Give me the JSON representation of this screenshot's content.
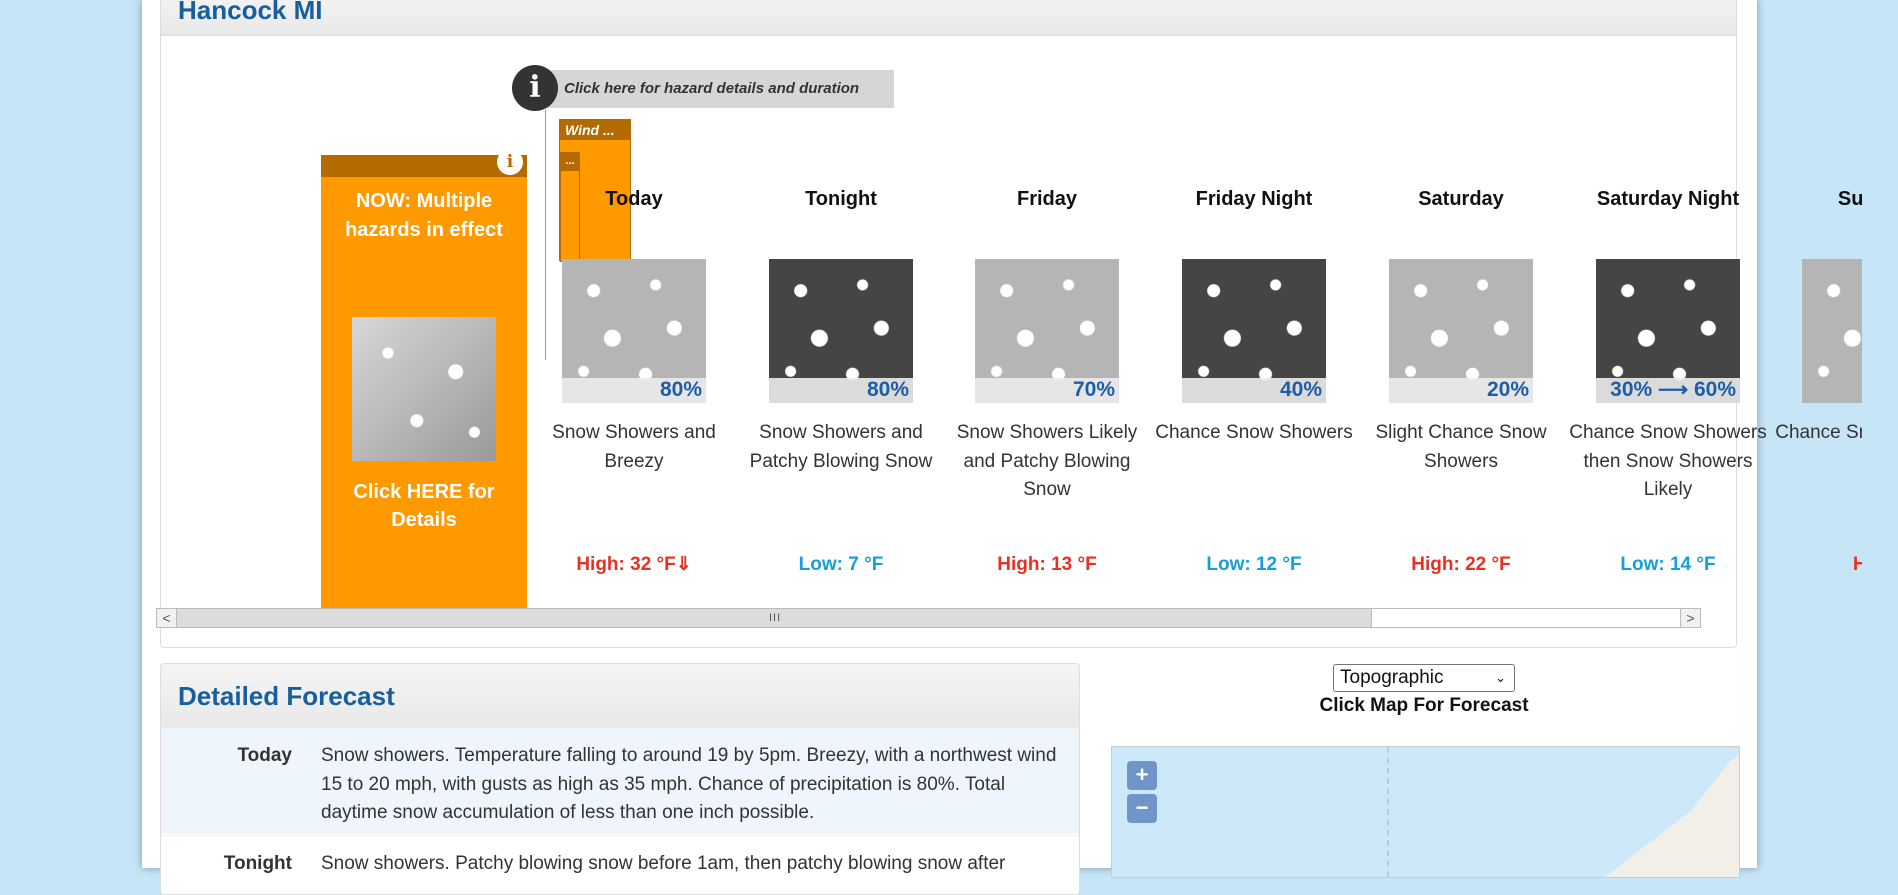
{
  "location_title": "Hancock MI",
  "hazard_button": {
    "label": "Click here for hazard details and duration"
  },
  "now_box": {
    "headline": "NOW: Multiple hazards in effect",
    "link": "Click HERE for Details"
  },
  "hazard_tabs": [
    {
      "label": "Wind ..."
    },
    {
      "label": "..."
    }
  ],
  "periods": [
    {
      "name": "Today",
      "pop": "80%",
      "icon": "snow-showers-icon",
      "shade": "light",
      "desc": "Snow Showers and Breezy",
      "temp": "High: 32 °F⇓",
      "temp_type": "hi"
    },
    {
      "name": "Tonight",
      "pop": "80%",
      "icon": "snow-showers-icon",
      "shade": "dark",
      "desc": "Snow Showers and Patchy Blowing Snow",
      "temp": "Low: 7 °F",
      "temp_type": "lo"
    },
    {
      "name": "Friday",
      "pop": "70%",
      "icon": "snow-showers-icon",
      "shade": "light",
      "desc": "Snow Showers Likely and Patchy Blowing Snow",
      "temp": "High: 13 °F",
      "temp_type": "hi"
    },
    {
      "name": "Friday Night",
      "pop": "40%",
      "icon": "snow-showers-icon",
      "shade": "dark",
      "desc": "Chance Snow Showers",
      "temp": "Low: 12 °F",
      "temp_type": "lo"
    },
    {
      "name": "Saturday",
      "pop": "20%",
      "icon": "snow-showers-icon",
      "shade": "light",
      "desc": "Slight Chance Snow Showers",
      "temp": "High: 22 °F",
      "temp_type": "hi"
    },
    {
      "name": "Saturday Night",
      "pop": "30% ⟶ 60%",
      "icon": "snow-showers-icon",
      "shade": "dark",
      "desc": "Chance Snow Showers then Snow Showers Likely",
      "temp": "Low: 14 °F",
      "temp_type": "lo"
    },
    {
      "name": "Sunday",
      "pop": "",
      "icon": "snow-showers-icon",
      "shade": "light",
      "desc": "Chance Snow Showers",
      "temp": "High",
      "temp_type": "hi"
    }
  ],
  "scrollbar": {
    "left_arrow": "<",
    "right_arrow": ">",
    "grip": "III"
  },
  "detailed_forecast": {
    "title": "Detailed Forecast",
    "rows": [
      {
        "label": "Today",
        "text": "Snow showers. Temperature falling to around 19 by 5pm. Breezy, with a northwest wind 15 to 20 mph, with gusts as high as 35 mph. Chance of precipitation is 80%. Total daytime snow accumulation of less than one inch possible."
      },
      {
        "label": "Tonight",
        "text": "Snow showers. Patchy blowing snow before 1am, then patchy blowing snow after"
      }
    ]
  },
  "map": {
    "type_select": {
      "selected": "Topographic"
    },
    "instruction": "Click Map For Forecast",
    "zoom_in": "+",
    "zoom_out": "−"
  },
  "colors": {
    "hazard_orange": "#ff9900",
    "high_temp": "#e53222",
    "low_temp": "#169fd9",
    "title_blue": "#175e9e"
  }
}
